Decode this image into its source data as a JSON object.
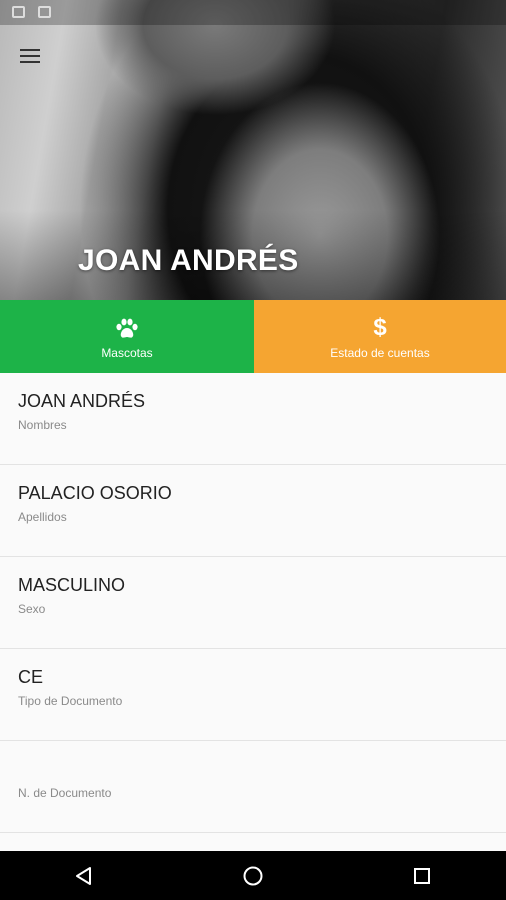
{
  "profile": {
    "display_name": "JOAN ANDRÉS"
  },
  "tabs": [
    {
      "label": "Mascotas",
      "icon": "paw-icon",
      "color": "#1db348"
    },
    {
      "label": "Estado de cuentas",
      "icon": "dollar-icon",
      "color": "#f5a531"
    }
  ],
  "fields": [
    {
      "value": "JOAN ANDRÉS",
      "label": "Nombres"
    },
    {
      "value": "PALACIO OSORIO",
      "label": "Apellidos"
    },
    {
      "value": "MASCULINO",
      "label": "Sexo"
    },
    {
      "value": "CE",
      "label": "Tipo de Documento"
    },
    {
      "value": "",
      "label": "N. de Documento"
    }
  ],
  "navbar": {
    "buttons": [
      "back-icon",
      "home-icon",
      "recents-icon"
    ]
  }
}
